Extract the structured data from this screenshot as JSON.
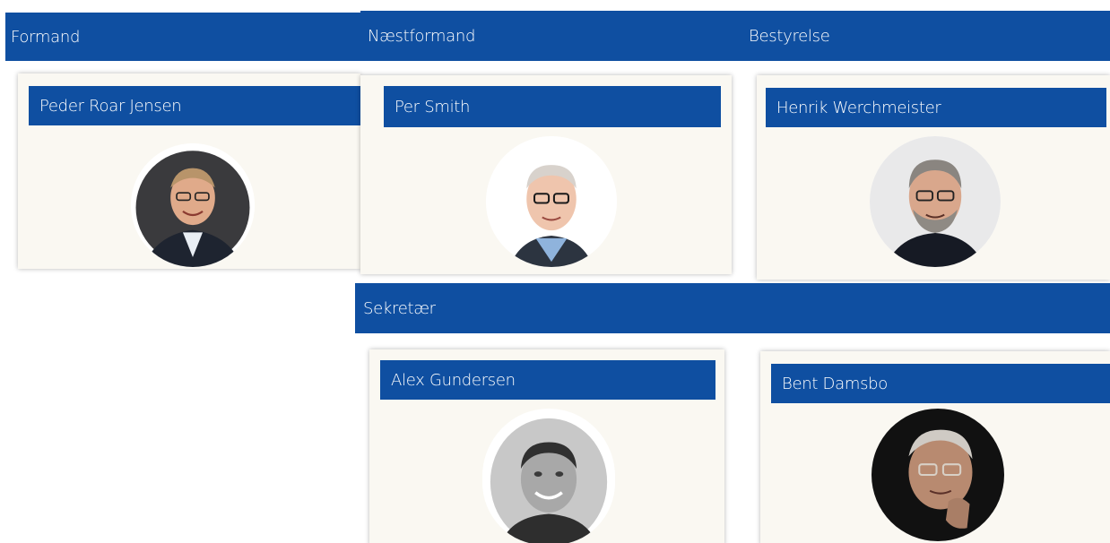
{
  "sections": {
    "formand": {
      "title": "Formand"
    },
    "naestformand": {
      "title": "Næstformand"
    },
    "bestyrelse": {
      "title": "Bestyrelse"
    },
    "sekretaer": {
      "title": "Sekretær"
    }
  },
  "members": [
    {
      "name": "Peder Roar Jensen",
      "photo": "member-portrait"
    },
    {
      "name": "Per Smith",
      "photo": "member-portrait"
    },
    {
      "name": "Henrik Werchmeister",
      "photo": "member-portrait"
    },
    {
      "name": "Alex Gundersen",
      "photo": "member-portrait"
    },
    {
      "name": "Bent Damsbo",
      "photo": "member-portrait"
    }
  ],
  "colors": {
    "header_blue": "#0f4fa1",
    "card_background": "#faf8f2",
    "header_text": "#ffffff"
  }
}
